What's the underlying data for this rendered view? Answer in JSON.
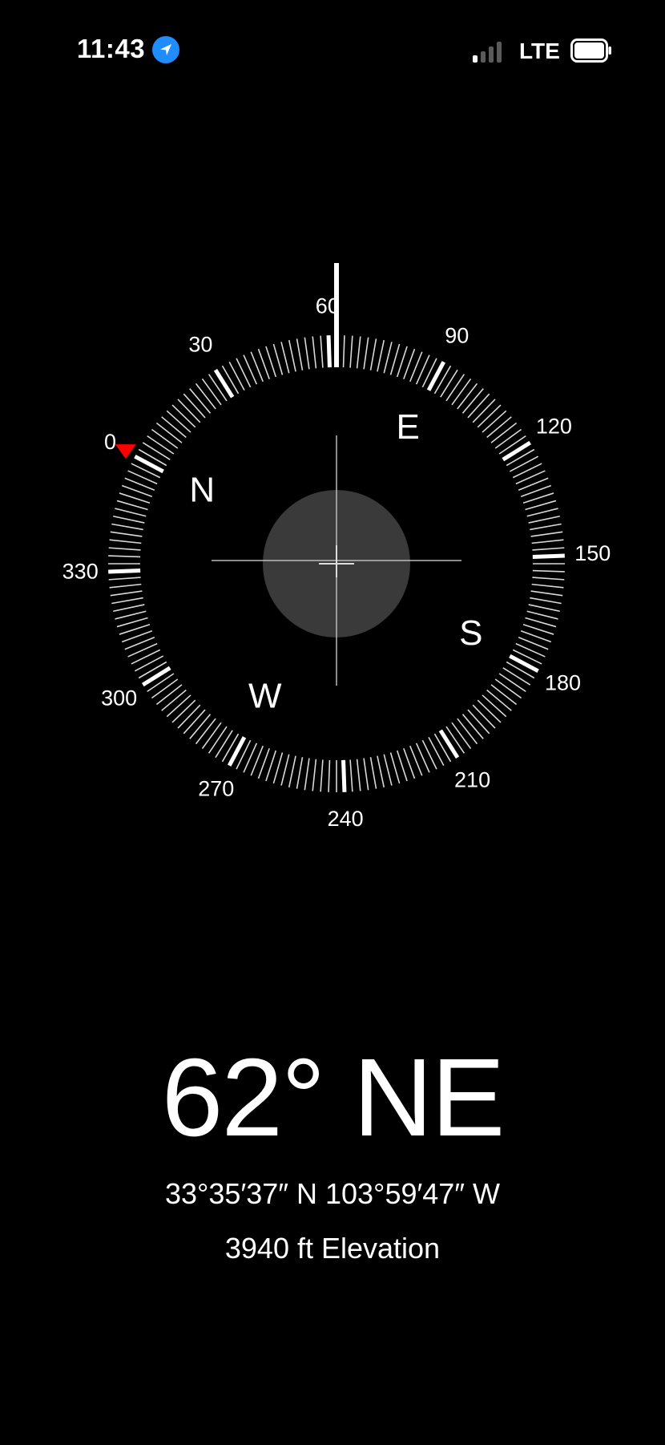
{
  "status_bar": {
    "time": "11:43",
    "location_icon": "location-arrow-icon",
    "signal_bars_active": 1,
    "signal_bars_total": 4,
    "network": "LTE",
    "battery_icon": "battery-full-icon"
  },
  "compass": {
    "heading_degrees": 62,
    "bearing_marker_degrees": 0,
    "bearing_marker_color": "#ff0000",
    "cardinals": [
      {
        "label": "N",
        "bearing": 0
      },
      {
        "label": "E",
        "bearing": 90
      },
      {
        "label": "S",
        "bearing": 180
      },
      {
        "label": "W",
        "bearing": 270
      }
    ],
    "degree_labels": [
      {
        "label": "0",
        "bearing": 0
      },
      {
        "label": "30",
        "bearing": 30
      },
      {
        "label": "60",
        "bearing": 60
      },
      {
        "label": "90",
        "bearing": 90
      },
      {
        "label": "120",
        "bearing": 120
      },
      {
        "label": "150",
        "bearing": 150
      },
      {
        "label": "180",
        "bearing": 180
      },
      {
        "label": "210",
        "bearing": 210
      },
      {
        "label": "240",
        "bearing": 240
      },
      {
        "label": "270",
        "bearing": 270
      },
      {
        "label": "300",
        "bearing": 300
      },
      {
        "label": "330",
        "bearing": 330
      }
    ]
  },
  "readout": {
    "heading": "62° NE",
    "coordinates": "33°35′37″ N  103°59′47″ W",
    "elevation": "3940 ft Elevation"
  }
}
